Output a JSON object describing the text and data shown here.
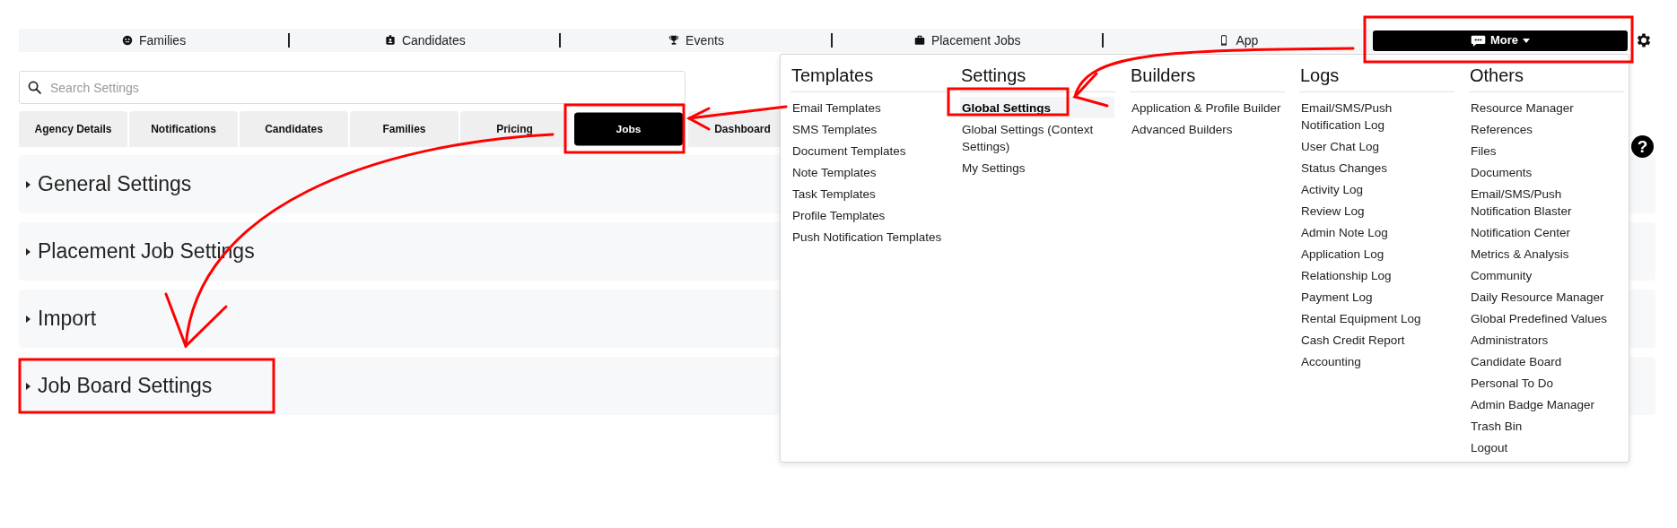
{
  "nav": {
    "items": [
      {
        "label": "Families"
      },
      {
        "label": "Candidates"
      },
      {
        "label": "Events"
      },
      {
        "label": "Placement Jobs"
      },
      {
        "label": "App"
      }
    ],
    "more_button": {
      "label": "More"
    }
  },
  "search": {
    "placeholder": "Search Settings"
  },
  "tabs": [
    {
      "label": "Agency Details",
      "selected": false
    },
    {
      "label": "Notifications",
      "selected": false
    },
    {
      "label": "Candidates",
      "selected": false
    },
    {
      "label": "Families",
      "selected": false
    },
    {
      "label": "Pricing",
      "selected": false
    },
    {
      "label": "Jobs",
      "selected": true
    },
    {
      "label": "Dashboard",
      "selected": false
    }
  ],
  "sections": [
    {
      "title": "General Settings",
      "expanded": false
    },
    {
      "title": "Placement Job Settings",
      "expanded": false
    },
    {
      "title": "Import",
      "expanded": false
    },
    {
      "title": "Job Board Settings",
      "expanded": false
    }
  ],
  "help_button": {
    "label": "?"
  },
  "menu": {
    "columns": [
      {
        "heading": "Templates",
        "items": [
          {
            "label": "Email Templates",
            "selected": false
          },
          {
            "label": "SMS Templates",
            "selected": false
          },
          {
            "label": "Document Templates",
            "selected": false
          },
          {
            "label": "Note Templates",
            "selected": false
          },
          {
            "label": "Task Templates",
            "selected": false
          },
          {
            "label": "Profile Templates",
            "selected": false
          },
          {
            "label": "Push Notification Templates",
            "selected": false
          }
        ]
      },
      {
        "heading": "Settings",
        "items": [
          {
            "label": "Global Settings",
            "selected": true
          },
          {
            "label": "Global Settings (Context Settings)",
            "selected": false
          },
          {
            "label": "My Settings",
            "selected": false
          }
        ]
      },
      {
        "heading": "Builders",
        "items": [
          {
            "label": "Application & Profile Builder",
            "selected": false
          },
          {
            "label": "Advanced Builders",
            "selected": false
          }
        ]
      },
      {
        "heading": "Logs",
        "items": [
          {
            "label": "Email/SMS/Push Notification Log",
            "selected": false
          },
          {
            "label": "User Chat Log",
            "selected": false
          },
          {
            "label": "Status Changes",
            "selected": false
          },
          {
            "label": "Activity Log",
            "selected": false
          },
          {
            "label": "Review Log",
            "selected": false
          },
          {
            "label": "Admin Note Log",
            "selected": false
          },
          {
            "label": "Application Log",
            "selected": false
          },
          {
            "label": "Relationship Log",
            "selected": false
          },
          {
            "label": "Payment Log",
            "selected": false
          },
          {
            "label": "Rental Equipment Log",
            "selected": false
          },
          {
            "label": "Cash Credit Report",
            "selected": false
          },
          {
            "label": "Accounting",
            "selected": false
          }
        ]
      },
      {
        "heading": "Others",
        "items": [
          {
            "label": "Resource Manager",
            "selected": false
          },
          {
            "label": "References",
            "selected": false
          },
          {
            "label": "Files",
            "selected": false
          },
          {
            "label": "Documents",
            "selected": false
          },
          {
            "label": "Email/SMS/Push Notification Blaster",
            "selected": false
          },
          {
            "label": "Notification Center",
            "selected": false
          },
          {
            "label": "Metrics & Analysis",
            "selected": false
          },
          {
            "label": "Community",
            "selected": false
          },
          {
            "label": "Daily Resource Manager",
            "selected": false
          },
          {
            "label": "Global Predefined Values",
            "selected": false
          },
          {
            "label": "Administrators",
            "selected": false
          },
          {
            "label": "Candidate Board",
            "selected": false
          },
          {
            "label": "Personal To Do",
            "selected": false
          },
          {
            "label": "Admin Badge Manager",
            "selected": false
          },
          {
            "label": "Trash Bin",
            "selected": false
          },
          {
            "label": "Logout",
            "selected": false
          }
        ]
      }
    ]
  }
}
